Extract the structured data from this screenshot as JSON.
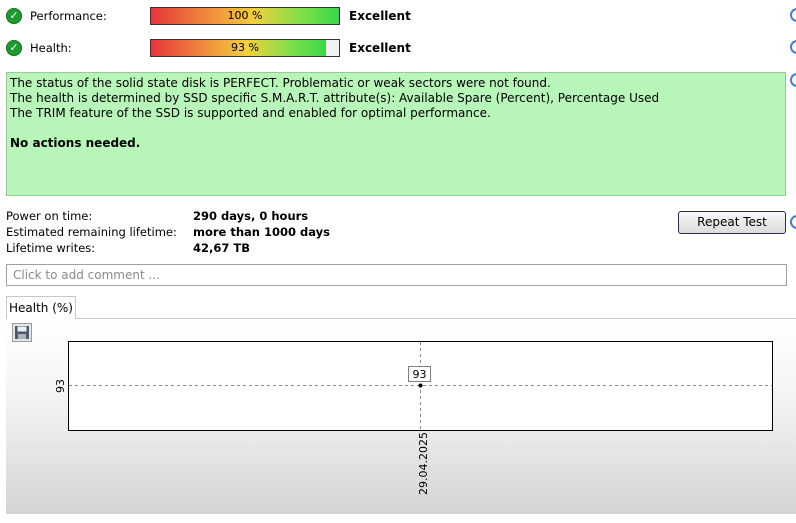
{
  "metrics": [
    {
      "label": "Performance:",
      "percent_text": "100 %",
      "level": 1.0,
      "rating": "Excellent"
    },
    {
      "label": "Health:",
      "percent_text": "93 %",
      "level": 0.93,
      "rating": "Excellent"
    }
  ],
  "status": {
    "lines": [
      "The status of the solid state disk is PERFECT. Problematic or weak sectors were not found.",
      "The health is determined by SSD specific S.M.A.R.T. attribute(s):  Available Spare (Percent), Percentage Used",
      "The TRIM feature of the SSD is supported and enabled for optimal performance."
    ],
    "action": "No actions needed."
  },
  "info": {
    "power_on_label": "Power on time:",
    "power_on_value": "290 days, 0 hours",
    "lifetime_label": "Estimated remaining lifetime:",
    "lifetime_value": "more than 1000 days",
    "writes_label": "Lifetime writes:",
    "writes_value": "42,67 TB"
  },
  "repeat_button": "Repeat Test",
  "comment": {
    "placeholder": "Click to add comment ...",
    "value": ""
  },
  "tab": {
    "label": "Health (%)"
  },
  "icons": {
    "check": "check-circle-icon",
    "save": "floppy-disk-icon"
  },
  "colors": {
    "status_bg": "#b8f5b8",
    "ok_green": "#1f9a2e"
  },
  "chart_data": {
    "type": "line",
    "x": [
      "29.04.2025"
    ],
    "series": [
      {
        "values": [
          93
        ]
      }
    ],
    "y_ticks": [
      "93"
    ],
    "data_labels": [
      "93"
    ],
    "grid": true
  }
}
